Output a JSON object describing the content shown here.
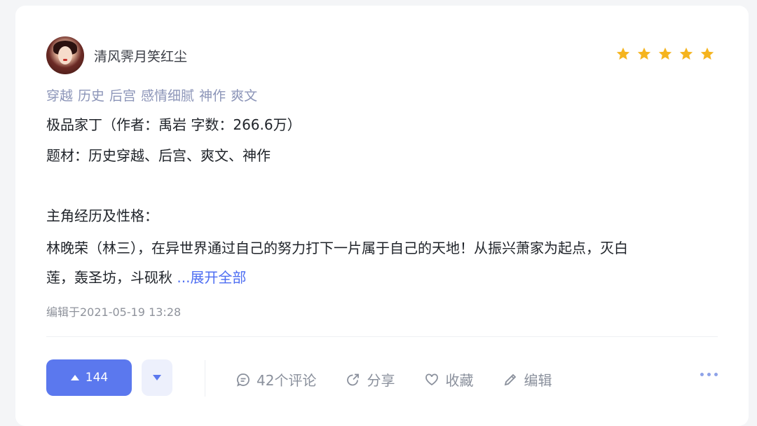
{
  "author": {
    "name": "清风霁月笑红尘"
  },
  "rating": {
    "stars": 5,
    "color": "#f5b41e"
  },
  "tags": [
    "穿越",
    "历史",
    "后宫",
    "感情细腻",
    "神作",
    "爽文"
  ],
  "content": {
    "line1": "极品家丁（作者：禹岩 字数：266.6万）",
    "line2": "题材：历史穿越、后宫、爽文、神作",
    "line3": "主角经历及性格：",
    "line4": "林晚荣（林三），在异世界通过自己的努力打下一片属于自己的天地！从振兴萧家为起点，灭白",
    "line5": "莲，轰圣坊，斗砚秋",
    "expand_label": "...展开全部"
  },
  "meta": {
    "edited": "编辑于2021-05-19 13:28"
  },
  "footer": {
    "upvote_count": "144",
    "comments_label": "42个评论",
    "share_label": "分享",
    "favorite_label": "收藏",
    "edit_label": "编辑"
  },
  "colors": {
    "accent": "#5b78ee",
    "tag": "#8c95b8",
    "link": "#4e6ef2"
  }
}
